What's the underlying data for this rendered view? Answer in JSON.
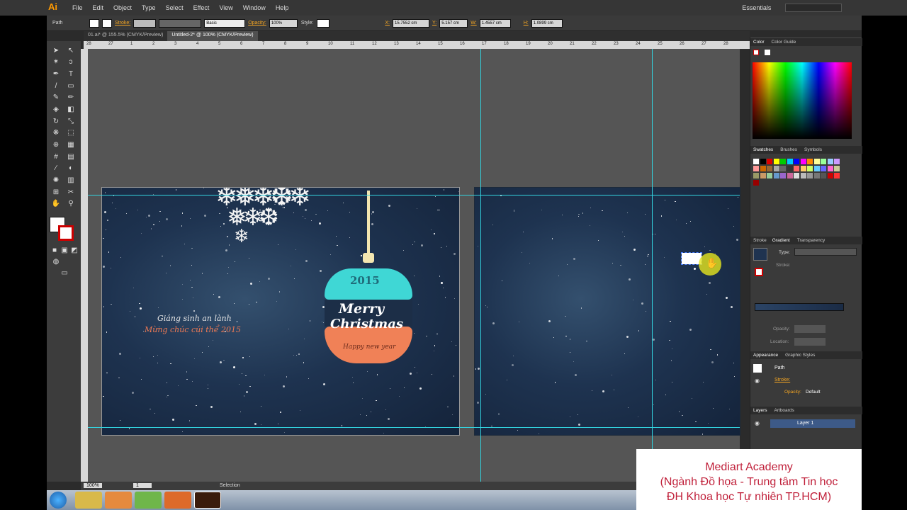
{
  "menu": {
    "items": [
      "File",
      "Edit",
      "Object",
      "Type",
      "Select",
      "Effect",
      "View",
      "Window",
      "Help"
    ],
    "workspace": "Essentials"
  },
  "control": {
    "selection": "Path",
    "stroke_label": "Stroke:",
    "brush": "Basic",
    "opacity_label": "Opacity:",
    "opacity": "100%",
    "style_label": "Style:",
    "x_label": "X:",
    "x": "15.7552 cm",
    "y_label": "Y:",
    "y": "5.157 cm",
    "w_label": "W:",
    "w": "1.4557 cm",
    "h_label": "H:",
    "h": "1.0899 cm"
  },
  "tabs": [
    "01.ai* @ 155.5% (CMYK/Preview)",
    "Untitled-2* @ 100% (CMYK/Preview)"
  ],
  "ruler_top": [
    "28",
    "27",
    "1",
    "2",
    "3",
    "4",
    "5",
    "6",
    "7",
    "8",
    "9",
    "10",
    "11",
    "12",
    "13",
    "14",
    "15",
    "16",
    "17",
    "18",
    "19",
    "20",
    "21",
    "22",
    "23",
    "24",
    "25",
    "26",
    "27",
    "28"
  ],
  "card": {
    "line1": "Giáng sinh an lành",
    "line2": "Mừng chúc cúi thể 2015",
    "year": "2015",
    "merry": "Merry",
    "christmas": "Christmas",
    "happy": "Happy new year"
  },
  "panels": {
    "color_tab": "Color",
    "colorguide_tab": "Color Guide",
    "swatches_tab": "Swatches",
    "brushes_tab": "Brushes",
    "symbols_tab": "Symbols",
    "stroke_tab": "Stroke",
    "gradient_tab": "Gradient",
    "transparency_tab": "Transparency",
    "type_label": "Type:",
    "stroke_label": "Stroke:",
    "opacity_label": "Opacity:",
    "location_label": "Location:",
    "appearance_tab": "Appearance",
    "graphic_styles_tab": "Graphic Styles",
    "path_label": "Path",
    "ap_stroke": "Stroke:",
    "ap_opacity": "Opacity:",
    "ap_opacity_val": "Default",
    "layers_tab": "Layers",
    "artboards_tab": "Artboards",
    "layer1": "Layer 1"
  },
  "status": {
    "zoom": "100%",
    "page": "1",
    "mode": "Selection"
  },
  "watermark": {
    "l1": "Mediart Academy",
    "l2": "(Ngành Đồ họa - Trung tâm Tin học",
    "l3": "ĐH Khoa học Tự nhiên TP.HCM)"
  },
  "colors": {
    "accent": "#f5a623",
    "guide": "#33d4e0",
    "ball_top": "#3fd7d5",
    "ball_bottom": "#f08157"
  }
}
